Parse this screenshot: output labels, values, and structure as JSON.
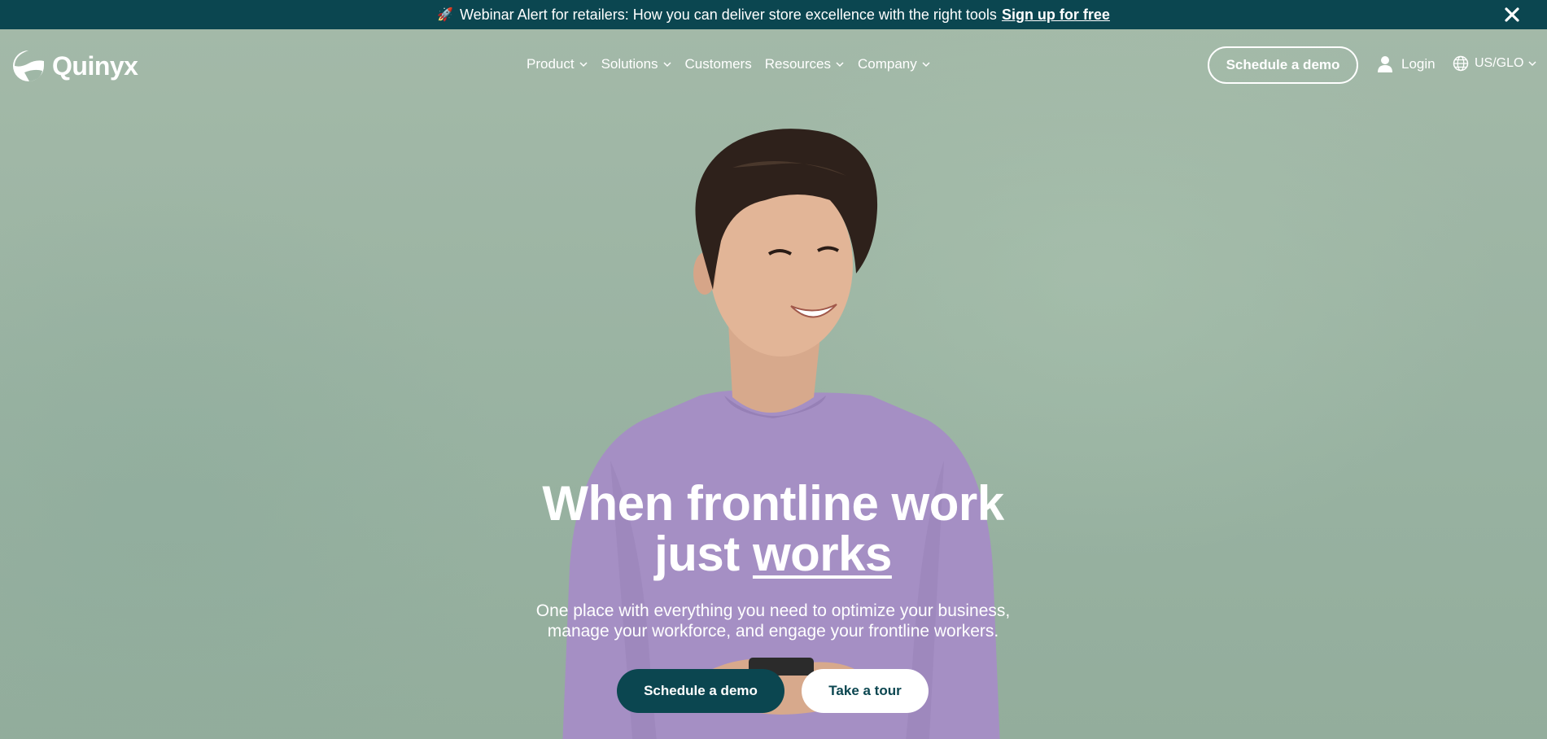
{
  "announcement": {
    "icon": "rocket-icon",
    "text": "Webinar Alert for retailers: How you can deliver store excellence with the right tools",
    "link_label": "Sign up for free",
    "close_icon": "close-icon"
  },
  "brand": {
    "name": "Quinyx",
    "logo_icon": "quinyx-logo-icon"
  },
  "nav": {
    "items": [
      {
        "label": "Product",
        "has_dropdown": true
      },
      {
        "label": "Solutions",
        "has_dropdown": true
      },
      {
        "label": "Customers",
        "has_dropdown": false
      },
      {
        "label": "Resources",
        "has_dropdown": true
      },
      {
        "label": "Company",
        "has_dropdown": true
      }
    ],
    "demo_button": "Schedule a demo",
    "login_label": "Login",
    "locale_label": "US/GLO"
  },
  "hero": {
    "headline_part1": "When frontline work",
    "headline_part2": "just",
    "headline_emphasis": "works",
    "subtext_line1": "One place with everything you need to optimize your business,",
    "subtext_line2": "manage your workforce, and engage your frontline workers.",
    "primary_cta": "Schedule a demo",
    "secondary_cta": "Take a tour"
  },
  "colors": {
    "brand_dark": "#0b4650",
    "hero_background": "#9fb7a6",
    "shirt": "#a58fc4",
    "white": "#ffffff"
  }
}
